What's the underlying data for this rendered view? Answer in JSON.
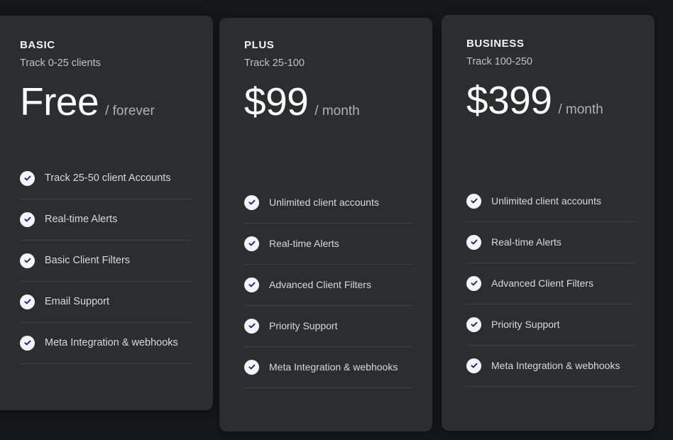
{
  "theme": {
    "page_background": "#15181a",
    "card_background": "#2b2d2f",
    "accent_check": "#2a1f6b",
    "check_circle": "#f4f4f6",
    "heading_color": "#f2f3f4",
    "muted_text": "#bfc3c6"
  },
  "plans": [
    {
      "name": "BASIC",
      "range": "Track 0-25 clients",
      "price": "Free",
      "period": "/ forever",
      "features": [
        "Track 25-50 client Accounts",
        "Real-time Alerts",
        "Basic Client Filters",
        "Email Support",
        "Meta Integration & webhooks"
      ]
    },
    {
      "name": "PLUS",
      "range": "Track 25-100",
      "price": "$99",
      "period": "/ month",
      "features": [
        "Unlimited client accounts",
        "Real-time Alerts",
        "Advanced Client Filters",
        "Priority Support",
        "Meta Integration & webhooks"
      ]
    },
    {
      "name": "BUSINESS",
      "range": "Track 100-250",
      "price": "$399",
      "period": "/ month",
      "features": [
        "Unlimited client accounts",
        "Real-time Alerts",
        "Advanced Client Filters",
        "Priority Support",
        "Meta Integration & webhooks"
      ]
    }
  ],
  "icons": {
    "check": "check-circle-icon"
  }
}
